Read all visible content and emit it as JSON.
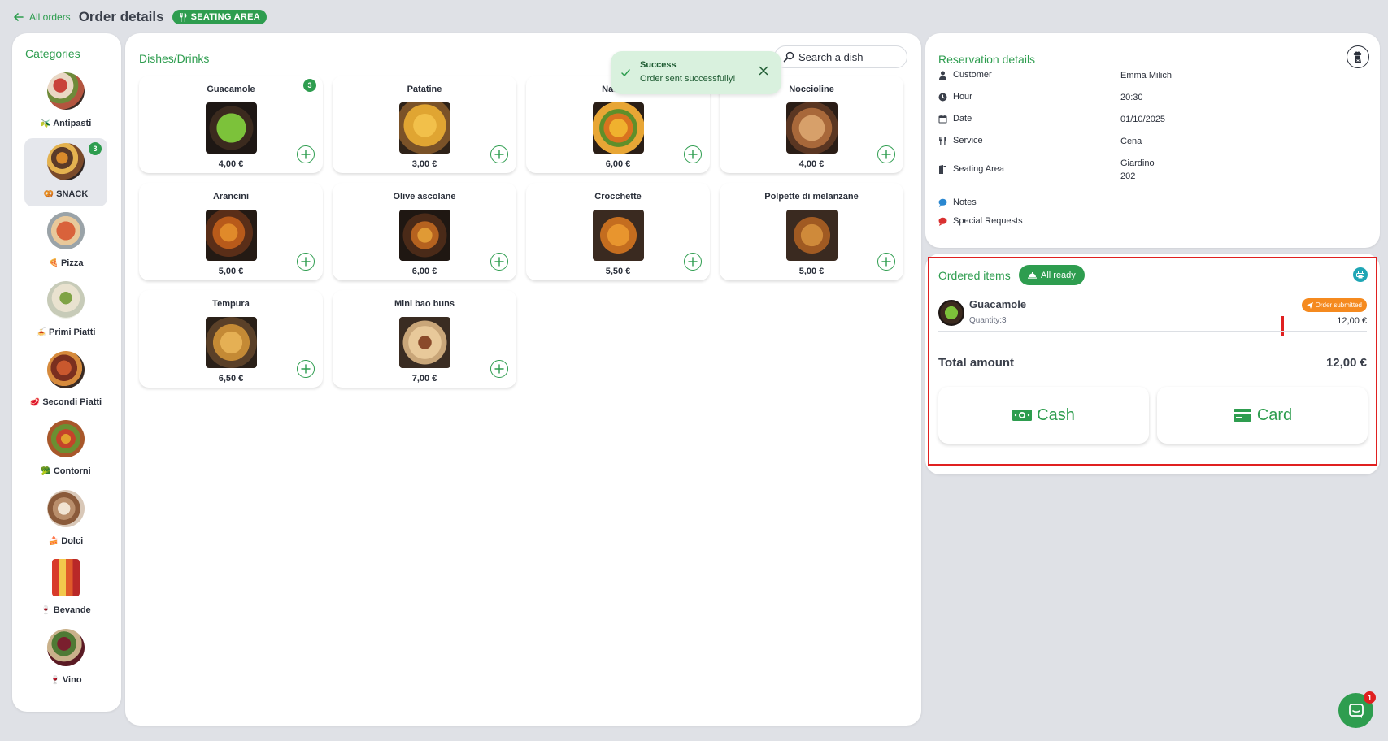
{
  "header": {
    "back_label": "All orders",
    "title": "Order details",
    "badge": "SEATING AREA"
  },
  "categories": {
    "title": "Categories",
    "items": [
      {
        "label": "Antipasti",
        "emoji": "🫒",
        "count": ""
      },
      {
        "label": "SNACK",
        "emoji": "🥨",
        "count": "3"
      },
      {
        "label": "Pizza",
        "emoji": "🍕",
        "count": ""
      },
      {
        "label": "Primi Piatti",
        "emoji": "🍝",
        "count": ""
      },
      {
        "label": "Secondi Piatti",
        "emoji": "🥩",
        "count": ""
      },
      {
        "label": "Contorni",
        "emoji": "🥦",
        "count": ""
      },
      {
        "label": "Dolci",
        "emoji": "🍰",
        "count": ""
      },
      {
        "label": "Bevande",
        "emoji": "🍷",
        "count": ""
      },
      {
        "label": "Vino",
        "emoji": "🍷",
        "count": ""
      }
    ]
  },
  "dishes": {
    "title": "Dishes/Drinks",
    "search_placeholder": "Search a dish",
    "items": [
      {
        "name": "Guacamole",
        "price": "4,00 €",
        "count": "3"
      },
      {
        "name": "Patatine",
        "price": "3,00 €",
        "count": ""
      },
      {
        "name": "Nachos",
        "price": "6,00 €",
        "count": ""
      },
      {
        "name": "Noccioline",
        "price": "4,00 €",
        "count": ""
      },
      {
        "name": "Arancini",
        "price": "5,00 €",
        "count": ""
      },
      {
        "name": "Olive ascolane",
        "price": "6,00 €",
        "count": ""
      },
      {
        "name": "Crocchette",
        "price": "5,50 €",
        "count": ""
      },
      {
        "name": "Polpette di melanzane",
        "price": "5,00 €",
        "count": ""
      },
      {
        "name": "Tempura",
        "price": "6,50 €",
        "count": ""
      },
      {
        "name": "Mini bao buns",
        "price": "7,00 €",
        "count": ""
      }
    ]
  },
  "toast": {
    "title": "Success",
    "message": "Order sent successfully!"
  },
  "reservation": {
    "title": "Reservation details",
    "rows": [
      {
        "label": "Customer",
        "value": "Emma Milich"
      },
      {
        "label": "Hour",
        "value": "20:30"
      },
      {
        "label": "Date",
        "value": "01/10/2025"
      },
      {
        "label": "Service",
        "value": "Cena"
      },
      {
        "label": "Seating Area",
        "value": "Giardino",
        "value2": "202"
      },
      {
        "label": "Notes",
        "value": ""
      },
      {
        "label": "Special Requests",
        "value": ""
      }
    ]
  },
  "ordered": {
    "title": "Ordered items",
    "all_ready_label": "All ready",
    "items": [
      {
        "name": "Guacamole",
        "quantity": "Quantity:3",
        "status": "Order submitted",
        "price": "12,00 €"
      }
    ],
    "total_label": "Total amount",
    "total_value": "12,00 €",
    "cash_label": "Cash",
    "card_label": "Card"
  },
  "chat": {
    "badge": "1"
  },
  "colors": {
    "accent": "#2e9d4f",
    "status_orange": "#f58a1f",
    "highlight_red": "#e02020",
    "teal": "#1fa6b5",
    "background": "#dfe1e6"
  }
}
